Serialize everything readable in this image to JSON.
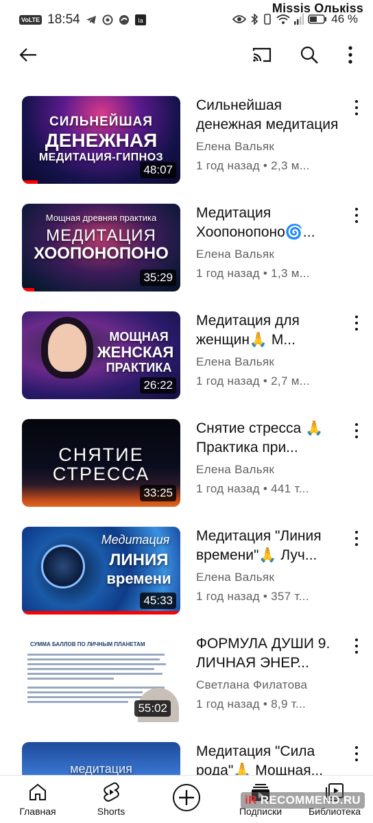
{
  "statusbar": {
    "volte": "VoLTE",
    "time": "18:54",
    "battery_percent": "46 %",
    "user_watermark": "Missis Олькiss"
  },
  "colors": {
    "progress": "#ff0000",
    "text_primary": "#0f0f0f",
    "text_secondary": "#606060"
  },
  "appbar": {
    "back_icon": "arrow-left-icon",
    "cast_icon": "cast-icon",
    "search_icon": "search-icon",
    "more_icon": "more-vertical-icon"
  },
  "videos": [
    {
      "title": "Сильнейшая денежная медитация",
      "channel": "Елена Вальяк",
      "age": "1 год назад",
      "views": "2,3 м...",
      "duration": "48:07",
      "thumb_lines": [
        "СИЛЬНЕЙШАЯ",
        "ДЕНЕЖНАЯ",
        "МЕДИТАЦИЯ-ГИПНОЗ"
      ],
      "progress": 0.1
    },
    {
      "title": "Медитация Хоопонопоно🌀...",
      "channel": "Елена Вальяк",
      "age": "1 год назад",
      "views": "1,3 м...",
      "duration": "35:29",
      "thumb_lines": [
        "Мощная древняя практика",
        "МЕДИТАЦИЯ",
        "ХООПОНОПОНО"
      ],
      "progress": 0.08
    },
    {
      "title": "Медитация для женщин🙏 М...",
      "channel": "Елена Вальяк",
      "age": "1 год назад",
      "views": "2,7 м...",
      "duration": "26:22",
      "thumb_lines": [
        "МОЩНАЯ",
        "ЖЕНСКАЯ",
        "ПРАКТИКА"
      ],
      "progress": 0
    },
    {
      "title": "Снятие стресса 🙏 Практика при...",
      "channel": "Елена Вальяк",
      "age": "1 год назад",
      "views": "441 т...",
      "duration": "33:25",
      "thumb_lines": [
        "СНЯТИЕ",
        "СТРЕССА"
      ],
      "progress": 0
    },
    {
      "title": "Медитация \"Линия времени\"🙏 Луч...",
      "channel": "Елена Вальяк",
      "age": "1 год назад",
      "views": "357 т...",
      "duration": "45:33",
      "thumb_lines": [
        "Медитация",
        "ЛИНИЯ",
        "времени"
      ],
      "progress": 1.0
    },
    {
      "title": "ФОРМУЛА ДУШИ 9. ЛИЧНАЯ ЭНЕР...",
      "channel": "Светлана Филатова",
      "age": "1 год назад",
      "views": "8,9 т...",
      "duration": "55:02",
      "thumb_lines": [
        "СУММА БАЛЛОВ ПО ЛИЧНЫМ ПЛАНЕТАМ"
      ],
      "progress": 0
    },
    {
      "title": "Медитация \"Сила рода\"🙏 Мощная...",
      "channel": "",
      "age": "",
      "views": "",
      "duration": "",
      "thumb_lines": [
        "медитация"
      ],
      "progress": 0
    }
  ],
  "bottomnav": {
    "home": "Главная",
    "shorts": "Shorts",
    "subscriptions": "Подписки",
    "library": "Библиотека"
  },
  "watermark": {
    "prefix": "iR",
    "text": "RECOMMEND.RU"
  }
}
